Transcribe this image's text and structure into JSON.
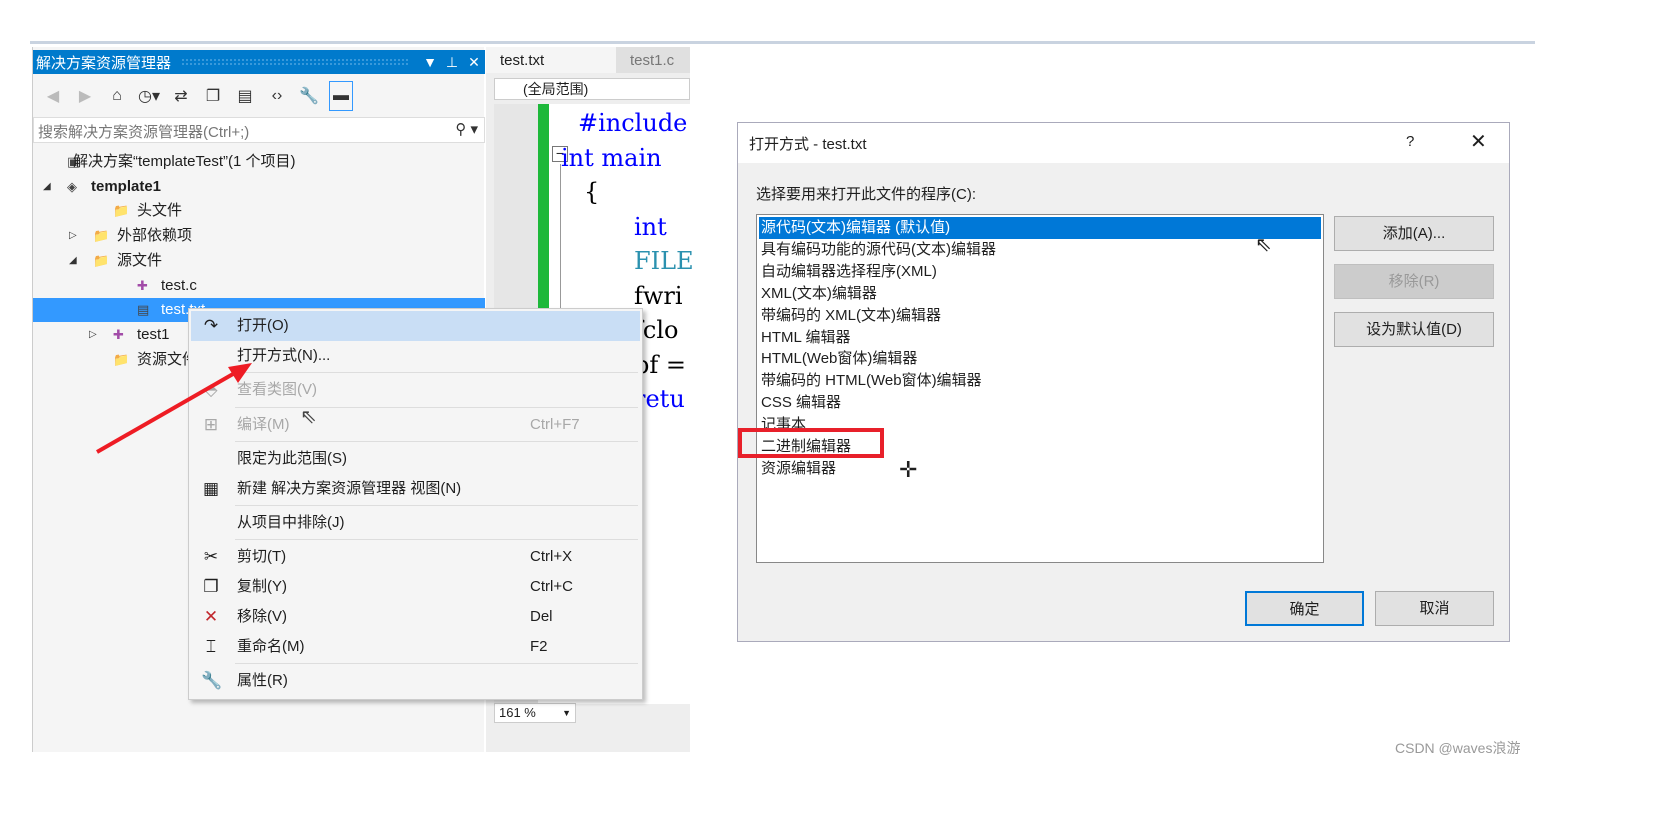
{
  "solution_explorer": {
    "title": "解决方案资源管理器",
    "search_placeholder": "搜索解决方案资源管理器(Ctrl+;)",
    "tree": [
      {
        "label": "解决方案“templateTest”(1 个项目)",
        "icon": "solution-icon"
      },
      {
        "label": "template1",
        "icon": "project-icon",
        "expanded": true,
        "bold": true
      },
      {
        "label": "头文件",
        "icon": "folder-icon"
      },
      {
        "label": "外部依赖项",
        "icon": "folder-icon",
        "expanded": false
      },
      {
        "label": "源文件",
        "icon": "folder-icon",
        "expanded": true
      },
      {
        "label": "test.c",
        "icon": "cpp-file-icon"
      },
      {
        "label": "test.txt",
        "icon": "text-file-icon",
        "selected": true
      },
      {
        "label": "test1",
        "icon": "cpp-file-icon",
        "expanded": false
      },
      {
        "label": "资源文件",
        "icon": "folder-icon"
      }
    ]
  },
  "editor": {
    "tabs": [
      {
        "label": "test.txt",
        "active": true
      },
      {
        "label": "test1.c",
        "active": false
      }
    ],
    "scope": "(全局范围)",
    "code_lines": [
      "#include",
      "int main",
      "{",
      "int",
      "FILE",
      "fwri",
      "fclo",
      "pf =",
      "retu"
    ],
    "zoom": "161 %"
  },
  "context_menu": {
    "items": [
      {
        "label": "打开(O)",
        "icon": "open-icon",
        "highlighted": true
      },
      {
        "label": "打开方式(N)..."
      },
      {
        "label": "查看类图(V)",
        "icon": "class-diagram-icon",
        "disabled": true
      },
      {
        "label": "编译(M)",
        "icon": "compile-icon",
        "shortcut": "Ctrl+F7",
        "disabled": true
      },
      {
        "label": "限定为此范围(S)"
      },
      {
        "label": "新建 解决方案资源管理器 视图(N)",
        "icon": "new-view-icon"
      },
      {
        "label": "从项目中排除(J)"
      },
      {
        "label": "剪切(T)",
        "icon": "cut-icon",
        "shortcut": "Ctrl+X"
      },
      {
        "label": "复制(Y)",
        "icon": "copy-icon",
        "shortcut": "Ctrl+C"
      },
      {
        "label": "移除(V)",
        "icon": "remove-icon",
        "shortcut": "Del"
      },
      {
        "label": "重命名(M)",
        "icon": "rename-icon",
        "shortcut": "F2"
      },
      {
        "label": "属性(R)",
        "icon": "wrench-icon"
      }
    ]
  },
  "dialog": {
    "title": "打开方式 - test.txt",
    "help": "?",
    "label": "选择要用来打开此文件的程序(C):",
    "programs": [
      "源代码(文本)编辑器 (默认值)",
      "具有编码功能的源代码(文本)编辑器",
      "自动编辑器选择程序(XML)",
      "XML(文本)编辑器",
      "带编码的 XML(文本)编辑器",
      "HTML 编辑器",
      "HTML(Web窗体)编辑器",
      "带编码的 HTML(Web窗体)编辑器",
      "CSS 编辑器",
      "记事本",
      "二进制编辑器",
      "资源编辑器"
    ],
    "selected": "源代码(文本)编辑器 (默认值)",
    "highlighted_annotation": "二进制编辑器",
    "buttons": {
      "add": "添加(A)...",
      "remove": "移除(R)",
      "set_default": "设为默认值(D)",
      "ok": "确定",
      "cancel": "取消"
    }
  },
  "watermark": "CSDN @waves浪游",
  "colors": {
    "accent": "#007acc",
    "selection": "#3399ff",
    "list_selection": "#0078d7",
    "annotation": "#e8202a"
  }
}
